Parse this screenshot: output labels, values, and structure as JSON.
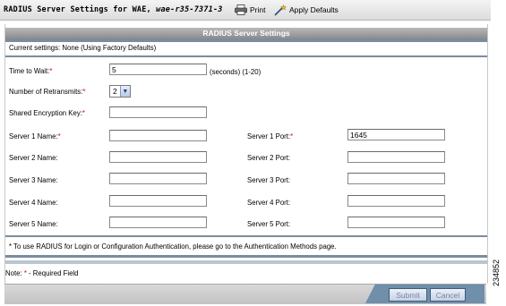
{
  "header": {
    "title_prefix": "RADIUS Server Settings for WAE, ",
    "title_host": "wae-r35-7371-3",
    "print_label": "Print",
    "apply_defaults_label": "Apply Defaults"
  },
  "section": {
    "title": "RADIUS Server Settings",
    "current_settings": "Current settings: None (Using Factory Defaults)"
  },
  "fields": {
    "time_to_wait": {
      "label": "Time to Wait:",
      "value": "5",
      "hint": "(seconds) (1-20)"
    },
    "retransmits": {
      "label": "Number of Retransmits:",
      "value": "2"
    },
    "encryption_key": {
      "label": "Shared Encryption Key:",
      "value": ""
    },
    "required_mark": "*"
  },
  "servers": [
    {
      "name_label": "Server 1 Name:",
      "name_value": "",
      "port_label": "Server 1 Port:",
      "port_value": "1645",
      "required": true
    },
    {
      "name_label": "Server 2 Name:",
      "name_value": "",
      "port_label": "Server 2 Port:",
      "port_value": "",
      "required": false
    },
    {
      "name_label": "Server 3 Name:",
      "name_value": "",
      "port_label": "Server 3 Port:",
      "port_value": "",
      "required": false
    },
    {
      "name_label": "Server 4 Name:",
      "name_value": "",
      "port_label": "Server 4 Port:",
      "port_value": "",
      "required": false
    },
    {
      "name_label": "Server 5 Name:",
      "name_value": "",
      "port_label": "Server 5 Port:",
      "port_value": "",
      "required": false
    }
  ],
  "notes": {
    "radius_note": "* To use RADIUS for Login or Configuration Authentication, please go to the Authentication Methods page.",
    "required_prefix": "Note: ",
    "required_suffix": " - Required Field"
  },
  "buttons": {
    "submit": "Submit",
    "cancel": "Cancel"
  },
  "figure_id": "234852",
  "colors": {
    "required": "#d40000",
    "accent_bar": "#7b8c9c",
    "footer_accent": "#6f8fab"
  }
}
